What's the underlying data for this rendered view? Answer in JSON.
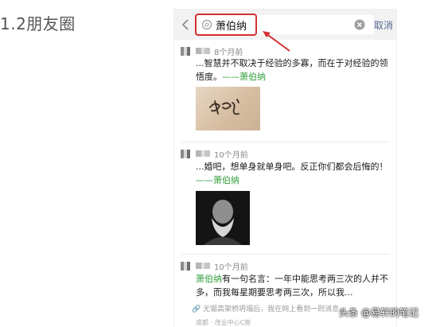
{
  "section_title": "1.2朋友圈",
  "search": {
    "value": "萧伯纳",
    "cancel_label": "取消"
  },
  "posts": [
    {
      "time": "8个月前",
      "text_before": "...智慧并不取决于经验的多寡，而在于对经验的领悟度。",
      "text_highlight": "——萧伯纳",
      "image": "signature-image"
    },
    {
      "time": "10个月前",
      "text_before": "...婚吧，想单身就单身吧。反正你们都会后悔的！",
      "text_highlight": "——萧伯纳",
      "image": "portrait-image"
    },
    {
      "time": "10个月前",
      "text_highlight": "萧伯纳",
      "text_before": "有一句名言：一年中能思考两三次的人并不多，而我每星期要思考两三次，所以我...",
      "link_text": "无锡高架桥坍塌后，我在网上看到一则消息，...",
      "location": "成都 · 茂业中心C座"
    }
  ],
  "watermark": "头条 @易轩的笔记",
  "colors": {
    "link_blue": "#576b95",
    "highlight_green": "#2e9e3a",
    "annotation_red": "#d32f2f"
  }
}
